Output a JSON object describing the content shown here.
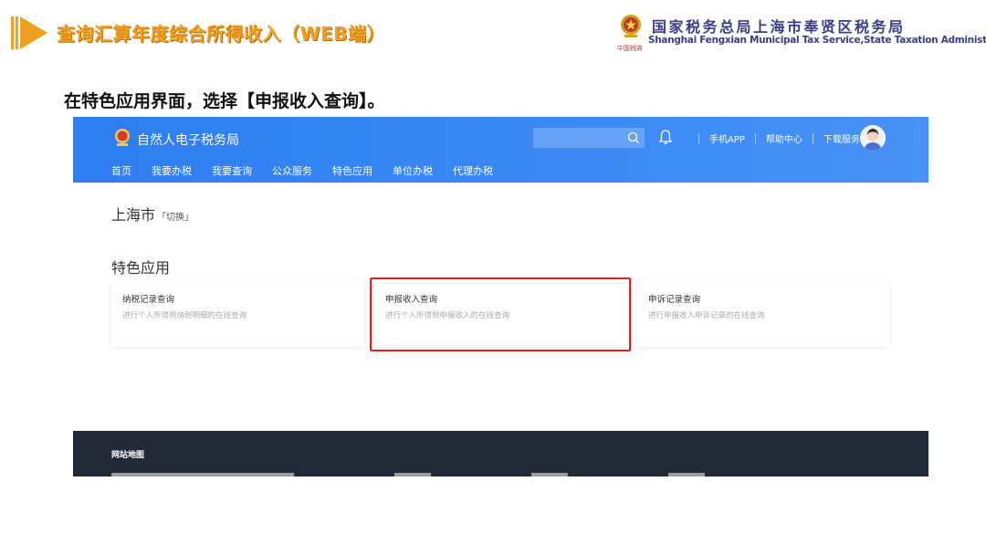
{
  "slide": {
    "title": "查询汇算年度综合所得收入（WEB端）",
    "subtitle": "在特色应用界面，选择【申报收入查询】。",
    "brand_cn": "国家税务总局上海市奉贤区税务局",
    "brand_en": "Shanghai Fengxian Municipal Tax Service,State Taxation Administration",
    "brand_sign": "中国税务"
  },
  "header": {
    "site_name": "自然人电子税务局",
    "links": [
      "手机APP",
      "帮助中心",
      "下载服务"
    ],
    "nav": [
      "首页",
      "我要办税",
      "我要查询",
      "公众服务",
      "特色应用",
      "单位办税",
      "代理办税"
    ],
    "active_nav": "特色应用"
  },
  "main": {
    "city": "上海市",
    "switch_label": "「切换」",
    "section_title": "特色应用",
    "cards": [
      {
        "title": "纳税记录查询",
        "desc": "进行个人所得税纳税明细的在线查询"
      },
      {
        "title": "申报收入查询",
        "desc": "进行个人所得税申报收入的在线查询"
      },
      {
        "title": "申诉记录查询",
        "desc": "进行申报收入申诉记录的在线查询"
      }
    ]
  },
  "footer": {
    "title": "网站地图"
  },
  "colors": {
    "topbar": "#3b8af5",
    "highlight": "#e0201c",
    "footer": "#212836",
    "slide_title": "#f0a023",
    "brand": "#3a3d88"
  },
  "icons": [
    "arrow-icon",
    "emblem-icon",
    "search-icon",
    "bell-icon",
    "avatar"
  ]
}
